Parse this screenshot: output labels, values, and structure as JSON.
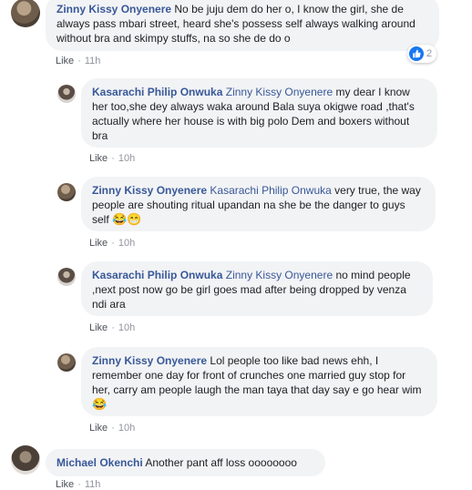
{
  "comments": [
    {
      "author": "Zinny Kissy Onyenere",
      "mention": "",
      "text": "No be juju dem do her o, I know the girl, she de always pass mbari street, heard she's possess self always walking around without bra and skimpy stuffs, na so she de do o",
      "like_label": "Like",
      "time": "11h",
      "reactions": "2"
    },
    {
      "author": "Kasarachi Philip Onwuka",
      "mention": "Zinny Kissy Onyenere",
      "text": "my dear I know her too,she dey always waka around Bala suya okigwe road ,that's actually where her house is with big polo Dem and boxers without bra",
      "like_label": "Like",
      "time": "10h"
    },
    {
      "author": "Zinny Kissy Onyenere",
      "mention": "Kasarachi Philip Onwuka",
      "text": "very true, the way people are shouting ritual upandan na she be the danger to guys self",
      "emoji": "😂😁",
      "like_label": "Like",
      "time": "10h"
    },
    {
      "author": "Kasarachi Philip Onwuka",
      "mention": "Zinny Kissy Onyenere",
      "text": "no mind people ,next post now go be girl goes mad after being dropped by venza ndi ara",
      "like_label": "Like",
      "time": "10h"
    },
    {
      "author": "Zinny Kissy Onyenere",
      "mention": "",
      "text": "Lol people too like bad news ehh, I remember one day for front of crunches one married guy stop for her, carry am people laugh the man taya that day say e go hear wim",
      "emoji": "😂",
      "like_label": "Like",
      "time": "10h"
    },
    {
      "author": "Michael Okenchi",
      "mention": "",
      "text": "Another pant aff loss oooooooo",
      "like_label": "Like",
      "time": "11h"
    }
  ],
  "icons": {
    "reaction": "like-thumb-icon",
    "avatar": "profile-photo"
  },
  "colors": {
    "link": "#385898",
    "bubble": "#f2f3f5",
    "like_blue": "#1877f2"
  }
}
